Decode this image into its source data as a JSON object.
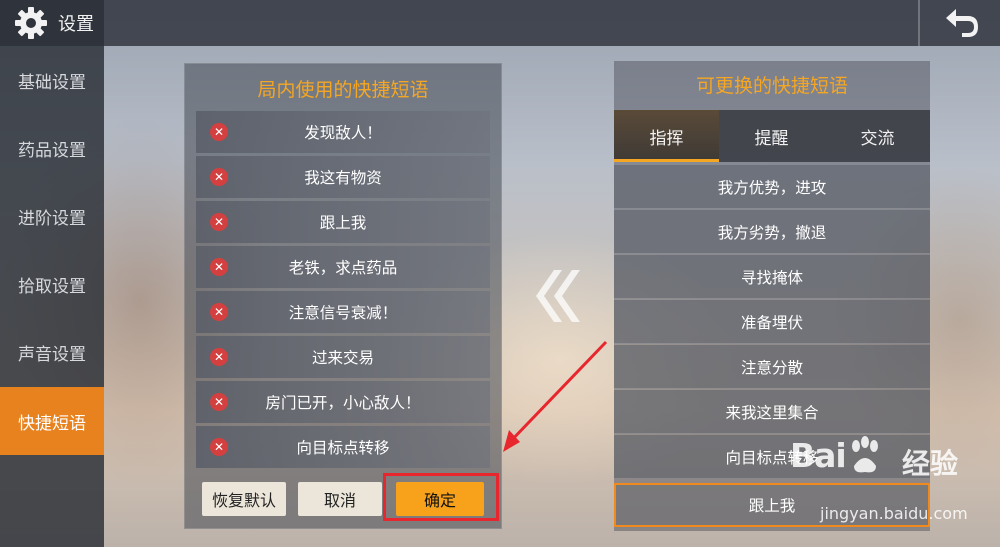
{
  "header": {
    "title": "设置"
  },
  "sidebar": {
    "items": [
      {
        "label": "基础设置"
      },
      {
        "label": "药品设置"
      },
      {
        "label": "进阶设置"
      },
      {
        "label": "拾取设置"
      },
      {
        "label": "声音设置"
      },
      {
        "label": "快捷短语",
        "active": true
      }
    ]
  },
  "left_panel": {
    "title": "局内使用的快捷短语",
    "phrases": [
      "发现敌人！",
      "我这有物资",
      "跟上我",
      "老铁，求点药品",
      "注意信号衰减！",
      "过来交易",
      "房门已开，小心敌人！",
      "向目标点转移"
    ],
    "buttons": {
      "restore": "恢复默认",
      "cancel": "取消",
      "confirm": "确定"
    }
  },
  "right_panel": {
    "title": "可更换的快捷短语",
    "tabs": [
      {
        "label": "指挥",
        "active": true
      },
      {
        "label": "提醒"
      },
      {
        "label": "交流"
      }
    ],
    "options": [
      "我方优势，进攻",
      "我方劣势，撤退",
      "寻找掩体",
      "准备埋伏",
      "注意分散",
      "来我这里集合",
      "向目标点转移",
      "跟上我"
    ]
  },
  "watermark": {
    "logo": "Bai",
    "logo2": "经验",
    "url": "jingyan.baidu.com"
  },
  "colors": {
    "accent": "#f5a623",
    "active_tab": "#e7821e",
    "confirm": "#f7a21a",
    "annotation": "#e8262d"
  }
}
